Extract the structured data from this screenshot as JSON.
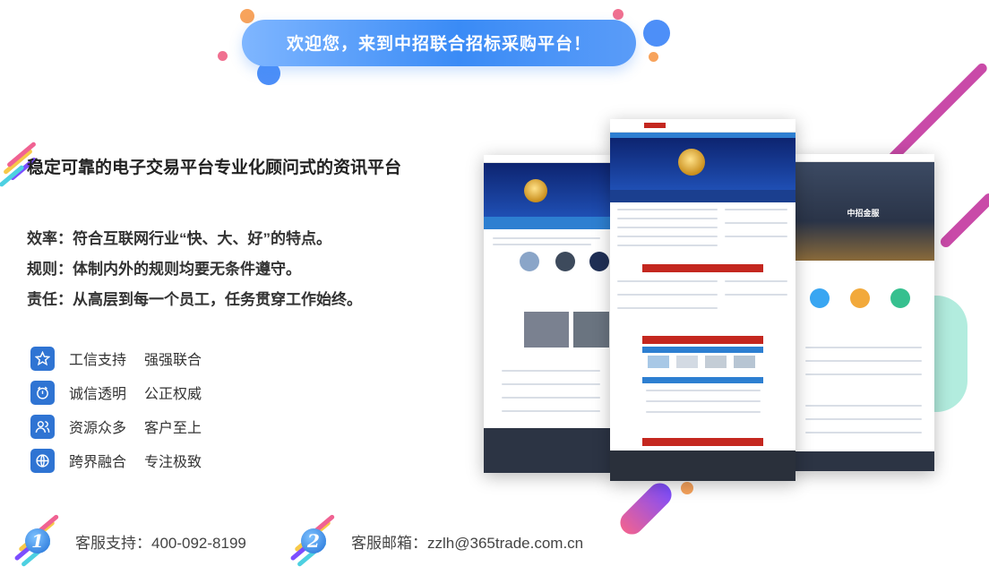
{
  "banner": {
    "text": "欢迎您，来到中招联合招标采购平台！"
  },
  "headline": "稳定可靠的电子交易平台专业化顾问式的资讯平台",
  "principles": [
    "效率：符合互联网行业“快、大、好”的特点。",
    "规则：体制内外的规则均要无条件遵守。",
    "责任：从高层到每一个员工，任务贯穿工作始终。"
  ],
  "features": [
    {
      "icon": "star-icon",
      "label": "工信支持",
      "label2": "强强联合"
    },
    {
      "icon": "clock-icon",
      "label": "诚信透明",
      "label2": "公正权威"
    },
    {
      "icon": "users-icon",
      "label": "资源众多",
      "label2": "客户至上"
    },
    {
      "icon": "globe-icon",
      "label": "跨界融合",
      "label2": "专注极致"
    }
  ],
  "contact": [
    {
      "num": "1",
      "text": "客服支持：400-092-8199"
    },
    {
      "num": "2",
      "text": "客服邮箱：zzlh@365trade.com.cn"
    }
  ],
  "screenshots": {
    "right_title": "中招金服"
  },
  "colors": {
    "accent": "#2f74d3",
    "banner": "#3a8bf6"
  }
}
